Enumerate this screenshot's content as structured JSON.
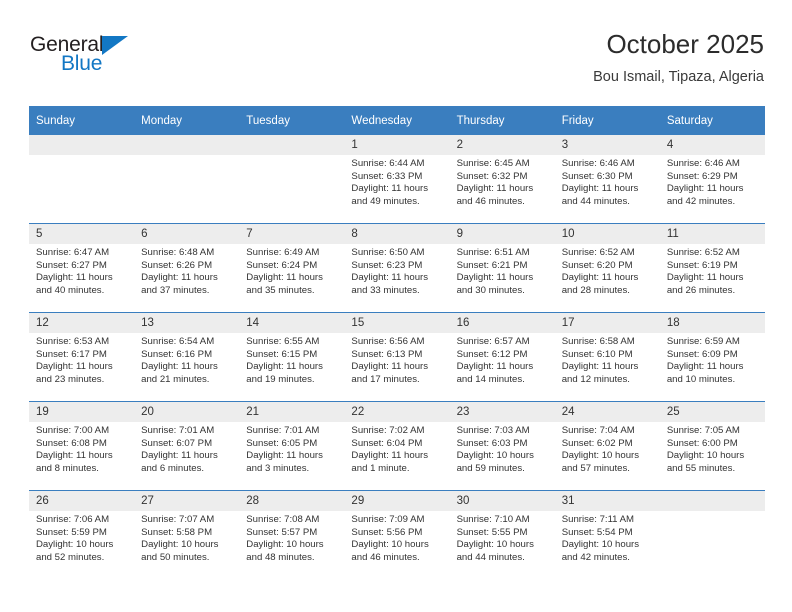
{
  "brand": {
    "name_part1": "General",
    "name_part2": "Blue",
    "triangle_color": "#1277c4"
  },
  "header": {
    "title": "October 2025",
    "location": "Bou Ismail, Tipaza, Algeria"
  },
  "theme": {
    "header_blue": "#3a7ebf",
    "daynum_band": "#ededed",
    "text": "#333333"
  },
  "weekdays": [
    "Sunday",
    "Monday",
    "Tuesday",
    "Wednesday",
    "Thursday",
    "Friday",
    "Saturday"
  ],
  "weeks": [
    [
      {
        "day": "",
        "empty": true
      },
      {
        "day": "",
        "empty": true
      },
      {
        "day": "",
        "empty": true
      },
      {
        "day": "1",
        "sunrise": "Sunrise: 6:44 AM",
        "sunset": "Sunset: 6:33 PM",
        "daylight": "Daylight: 11 hours and 49 minutes."
      },
      {
        "day": "2",
        "sunrise": "Sunrise: 6:45 AM",
        "sunset": "Sunset: 6:32 PM",
        "daylight": "Daylight: 11 hours and 46 minutes."
      },
      {
        "day": "3",
        "sunrise": "Sunrise: 6:46 AM",
        "sunset": "Sunset: 6:30 PM",
        "daylight": "Daylight: 11 hours and 44 minutes."
      },
      {
        "day": "4",
        "sunrise": "Sunrise: 6:46 AM",
        "sunset": "Sunset: 6:29 PM",
        "daylight": "Daylight: 11 hours and 42 minutes."
      }
    ],
    [
      {
        "day": "5",
        "sunrise": "Sunrise: 6:47 AM",
        "sunset": "Sunset: 6:27 PM",
        "daylight": "Daylight: 11 hours and 40 minutes."
      },
      {
        "day": "6",
        "sunrise": "Sunrise: 6:48 AM",
        "sunset": "Sunset: 6:26 PM",
        "daylight": "Daylight: 11 hours and 37 minutes."
      },
      {
        "day": "7",
        "sunrise": "Sunrise: 6:49 AM",
        "sunset": "Sunset: 6:24 PM",
        "daylight": "Daylight: 11 hours and 35 minutes."
      },
      {
        "day": "8",
        "sunrise": "Sunrise: 6:50 AM",
        "sunset": "Sunset: 6:23 PM",
        "daylight": "Daylight: 11 hours and 33 minutes."
      },
      {
        "day": "9",
        "sunrise": "Sunrise: 6:51 AM",
        "sunset": "Sunset: 6:21 PM",
        "daylight": "Daylight: 11 hours and 30 minutes."
      },
      {
        "day": "10",
        "sunrise": "Sunrise: 6:52 AM",
        "sunset": "Sunset: 6:20 PM",
        "daylight": "Daylight: 11 hours and 28 minutes."
      },
      {
        "day": "11",
        "sunrise": "Sunrise: 6:52 AM",
        "sunset": "Sunset: 6:19 PM",
        "daylight": "Daylight: 11 hours and 26 minutes."
      }
    ],
    [
      {
        "day": "12",
        "sunrise": "Sunrise: 6:53 AM",
        "sunset": "Sunset: 6:17 PM",
        "daylight": "Daylight: 11 hours and 23 minutes."
      },
      {
        "day": "13",
        "sunrise": "Sunrise: 6:54 AM",
        "sunset": "Sunset: 6:16 PM",
        "daylight": "Daylight: 11 hours and 21 minutes."
      },
      {
        "day": "14",
        "sunrise": "Sunrise: 6:55 AM",
        "sunset": "Sunset: 6:15 PM",
        "daylight": "Daylight: 11 hours and 19 minutes."
      },
      {
        "day": "15",
        "sunrise": "Sunrise: 6:56 AM",
        "sunset": "Sunset: 6:13 PM",
        "daylight": "Daylight: 11 hours and 17 minutes."
      },
      {
        "day": "16",
        "sunrise": "Sunrise: 6:57 AM",
        "sunset": "Sunset: 6:12 PM",
        "daylight": "Daylight: 11 hours and 14 minutes."
      },
      {
        "day": "17",
        "sunrise": "Sunrise: 6:58 AM",
        "sunset": "Sunset: 6:10 PM",
        "daylight": "Daylight: 11 hours and 12 minutes."
      },
      {
        "day": "18",
        "sunrise": "Sunrise: 6:59 AM",
        "sunset": "Sunset: 6:09 PM",
        "daylight": "Daylight: 11 hours and 10 minutes."
      }
    ],
    [
      {
        "day": "19",
        "sunrise": "Sunrise: 7:00 AM",
        "sunset": "Sunset: 6:08 PM",
        "daylight": "Daylight: 11 hours and 8 minutes."
      },
      {
        "day": "20",
        "sunrise": "Sunrise: 7:01 AM",
        "sunset": "Sunset: 6:07 PM",
        "daylight": "Daylight: 11 hours and 6 minutes."
      },
      {
        "day": "21",
        "sunrise": "Sunrise: 7:01 AM",
        "sunset": "Sunset: 6:05 PM",
        "daylight": "Daylight: 11 hours and 3 minutes."
      },
      {
        "day": "22",
        "sunrise": "Sunrise: 7:02 AM",
        "sunset": "Sunset: 6:04 PM",
        "daylight": "Daylight: 11 hours and 1 minute."
      },
      {
        "day": "23",
        "sunrise": "Sunrise: 7:03 AM",
        "sunset": "Sunset: 6:03 PM",
        "daylight": "Daylight: 10 hours and 59 minutes."
      },
      {
        "day": "24",
        "sunrise": "Sunrise: 7:04 AM",
        "sunset": "Sunset: 6:02 PM",
        "daylight": "Daylight: 10 hours and 57 minutes."
      },
      {
        "day": "25",
        "sunrise": "Sunrise: 7:05 AM",
        "sunset": "Sunset: 6:00 PM",
        "daylight": "Daylight: 10 hours and 55 minutes."
      }
    ],
    [
      {
        "day": "26",
        "sunrise": "Sunrise: 7:06 AM",
        "sunset": "Sunset: 5:59 PM",
        "daylight": "Daylight: 10 hours and 52 minutes."
      },
      {
        "day": "27",
        "sunrise": "Sunrise: 7:07 AM",
        "sunset": "Sunset: 5:58 PM",
        "daylight": "Daylight: 10 hours and 50 minutes."
      },
      {
        "day": "28",
        "sunrise": "Sunrise: 7:08 AM",
        "sunset": "Sunset: 5:57 PM",
        "daylight": "Daylight: 10 hours and 48 minutes."
      },
      {
        "day": "29",
        "sunrise": "Sunrise: 7:09 AM",
        "sunset": "Sunset: 5:56 PM",
        "daylight": "Daylight: 10 hours and 46 minutes."
      },
      {
        "day": "30",
        "sunrise": "Sunrise: 7:10 AM",
        "sunset": "Sunset: 5:55 PM",
        "daylight": "Daylight: 10 hours and 44 minutes."
      },
      {
        "day": "31",
        "sunrise": "Sunrise: 7:11 AM",
        "sunset": "Sunset: 5:54 PM",
        "daylight": "Daylight: 10 hours and 42 minutes."
      },
      {
        "day": "",
        "empty": true
      }
    ]
  ]
}
